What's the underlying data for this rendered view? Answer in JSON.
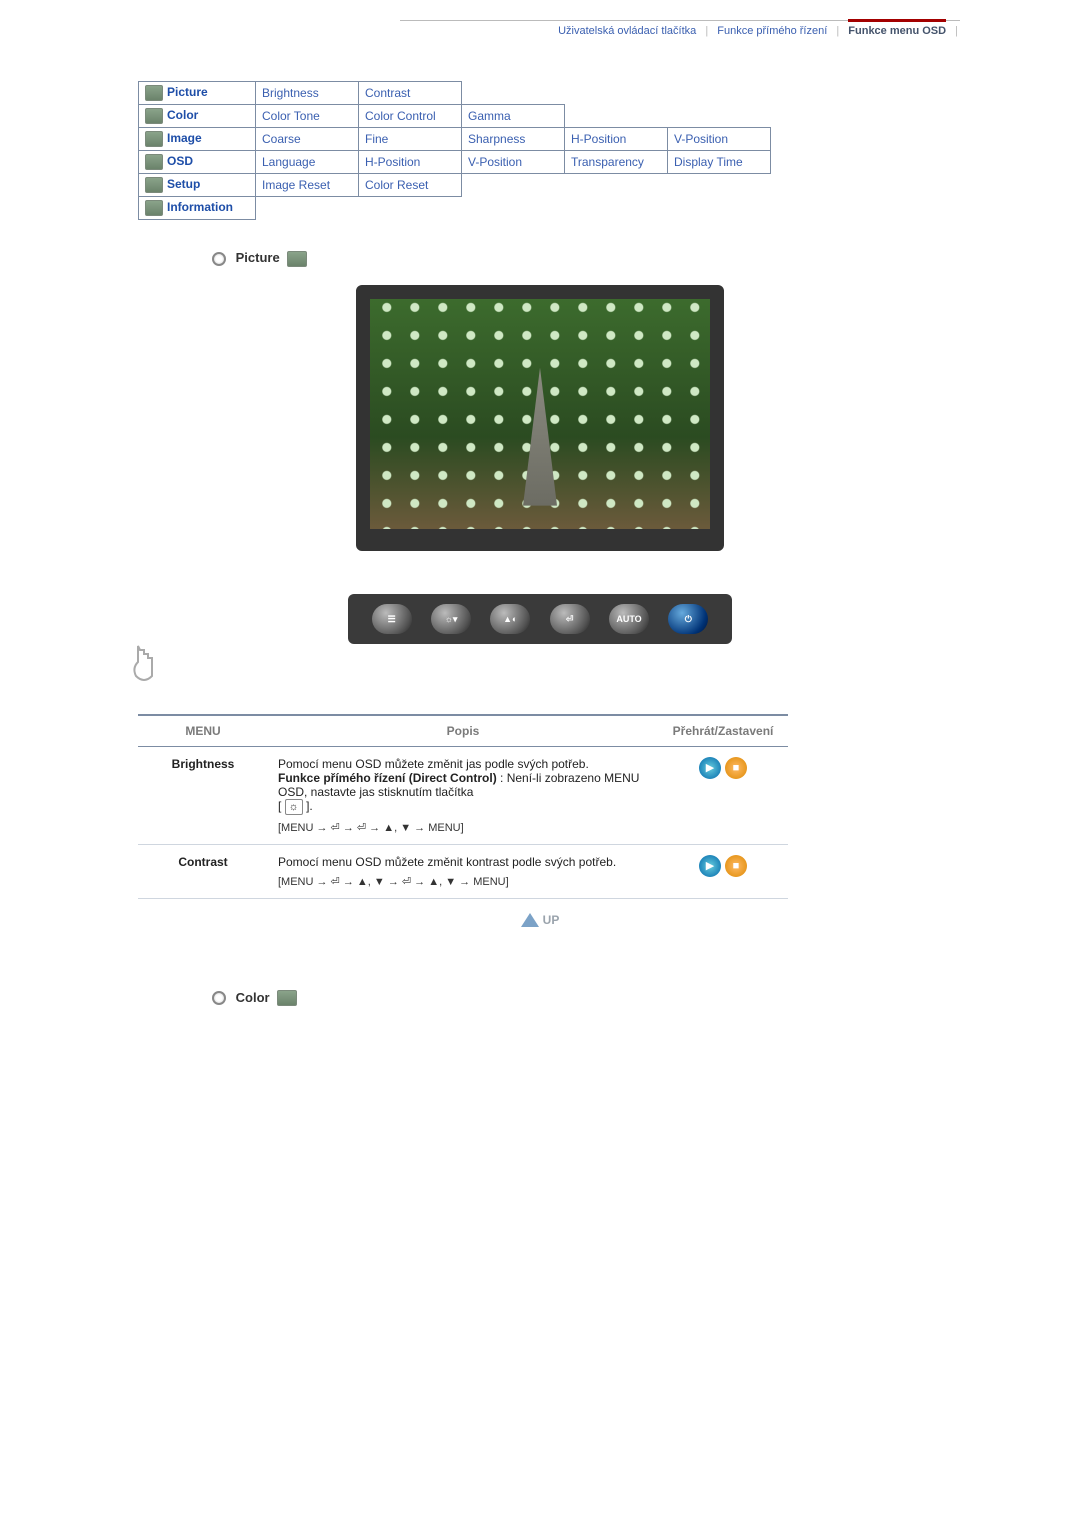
{
  "tabs": {
    "a": "Uživatelská ovládací tlačítka",
    "b": "Funkce přímého řízení",
    "c": "Funkce menu OSD"
  },
  "nav": {
    "rows": [
      {
        "label": "Picture",
        "cells": [
          "Brightness",
          "Contrast",
          "",
          "",
          ""
        ]
      },
      {
        "label": "Color",
        "cells": [
          "Color Tone",
          "Color Control",
          "Gamma",
          "",
          ""
        ]
      },
      {
        "label": "Image",
        "cells": [
          "Coarse",
          "Fine",
          "Sharpness",
          "H-Position",
          "V-Position"
        ]
      },
      {
        "label": "OSD",
        "cells": [
          "Language",
          "H-Position",
          "V-Position",
          "Transparency",
          "Display Time"
        ]
      },
      {
        "label": "Setup",
        "cells": [
          "Image Reset",
          "Color Reset",
          "",
          "",
          ""
        ]
      },
      {
        "label": "Information",
        "cells": [
          "",
          "",
          "",
          "",
          ""
        ]
      }
    ]
  },
  "section1": {
    "title": "Picture"
  },
  "bezel": {
    "auto": "AUTO"
  },
  "table": {
    "head": {
      "c1": "MENU",
      "c2": "Popis",
      "c3": "Přehrát/Zastavení"
    },
    "rows": [
      {
        "menu": "Brightness",
        "desc1": "Pomocí menu OSD můžete změnit jas podle svých potřeb.",
        "desc_bold": "Funkce přímého řízení (Direct Control)",
        "desc2": " : Není-li zobrazeno MENU OSD, nastavte jas stisknutím tlačítka",
        "path": "[MENU → ⏎ → ⏎ → ▲, ▼ → MENU]"
      },
      {
        "menu": "Contrast",
        "desc1": "Pomocí menu OSD můžete změnit kontrast podle svých potřeb.",
        "path": "[MENU → ⏎ → ▲, ▼ → ⏎ → ▲, ▼ → MENU]"
      }
    ]
  },
  "up": "UP",
  "section2": {
    "title": "Color"
  }
}
